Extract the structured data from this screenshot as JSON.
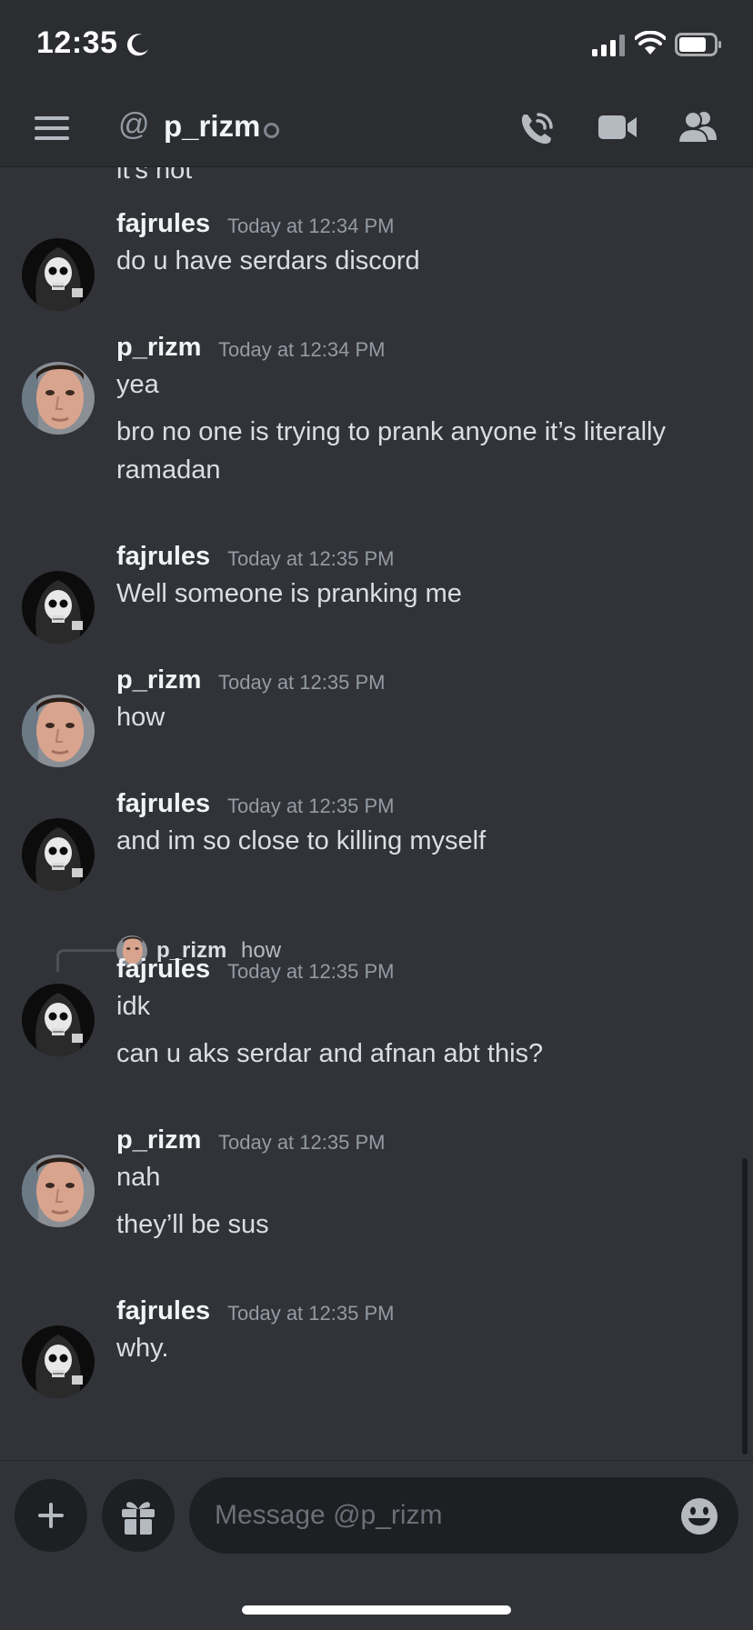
{
  "status_bar": {
    "time": "12:35"
  },
  "header": {
    "channel_prefix": "@",
    "channel_name": "p_rizm"
  },
  "messages": {
    "partial_top_text": "it’s not",
    "groups": [
      {
        "author": "fajrules",
        "time": "Today at 12:34 PM",
        "lines": [
          "do u have serdars discord"
        ]
      },
      {
        "author": "p_rizm",
        "time": "Today at 12:34 PM",
        "lines": [
          "yea",
          "bro no one is trying to prank anyone it’s literally ramadan"
        ]
      },
      {
        "author": "fajrules",
        "time": "Today at 12:35 PM",
        "lines": [
          "Well someone is pranking me"
        ]
      },
      {
        "author": "p_rizm",
        "time": "Today at 12:35 PM",
        "lines": [
          "how"
        ]
      },
      {
        "author": "fajrules",
        "time": "Today at 12:35 PM",
        "lines": [
          "and im so close to killing myself"
        ]
      },
      {
        "reply": {
          "author": "p_rizm",
          "text": "how"
        },
        "author": "fajrules",
        "time": "Today at 12:35 PM",
        "lines": [
          "idk",
          "can u aks serdar and afnan abt this?"
        ]
      },
      {
        "author": "p_rizm",
        "time": "Today at 12:35 PM",
        "lines": [
          "nah",
          "they’ll be sus"
        ]
      },
      {
        "author": "fajrules",
        "time": "Today at 12:35 PM",
        "lines": [
          "why."
        ]
      }
    ]
  },
  "composer": {
    "placeholder": "Message @p_rizm"
  },
  "icons": {
    "menu": "hamburger-menu-icon",
    "call": "phone-call-icon",
    "video": "video-camera-icon",
    "members": "members-icon",
    "add": "plus-icon",
    "gift": "gift-icon",
    "emoji": "smiley-emoji-icon",
    "moon": "moon-icon"
  },
  "colors": {
    "background": "#313338",
    "header": "#2b2d31",
    "input": "#1e1f22",
    "muted_text": "#949ba4"
  }
}
